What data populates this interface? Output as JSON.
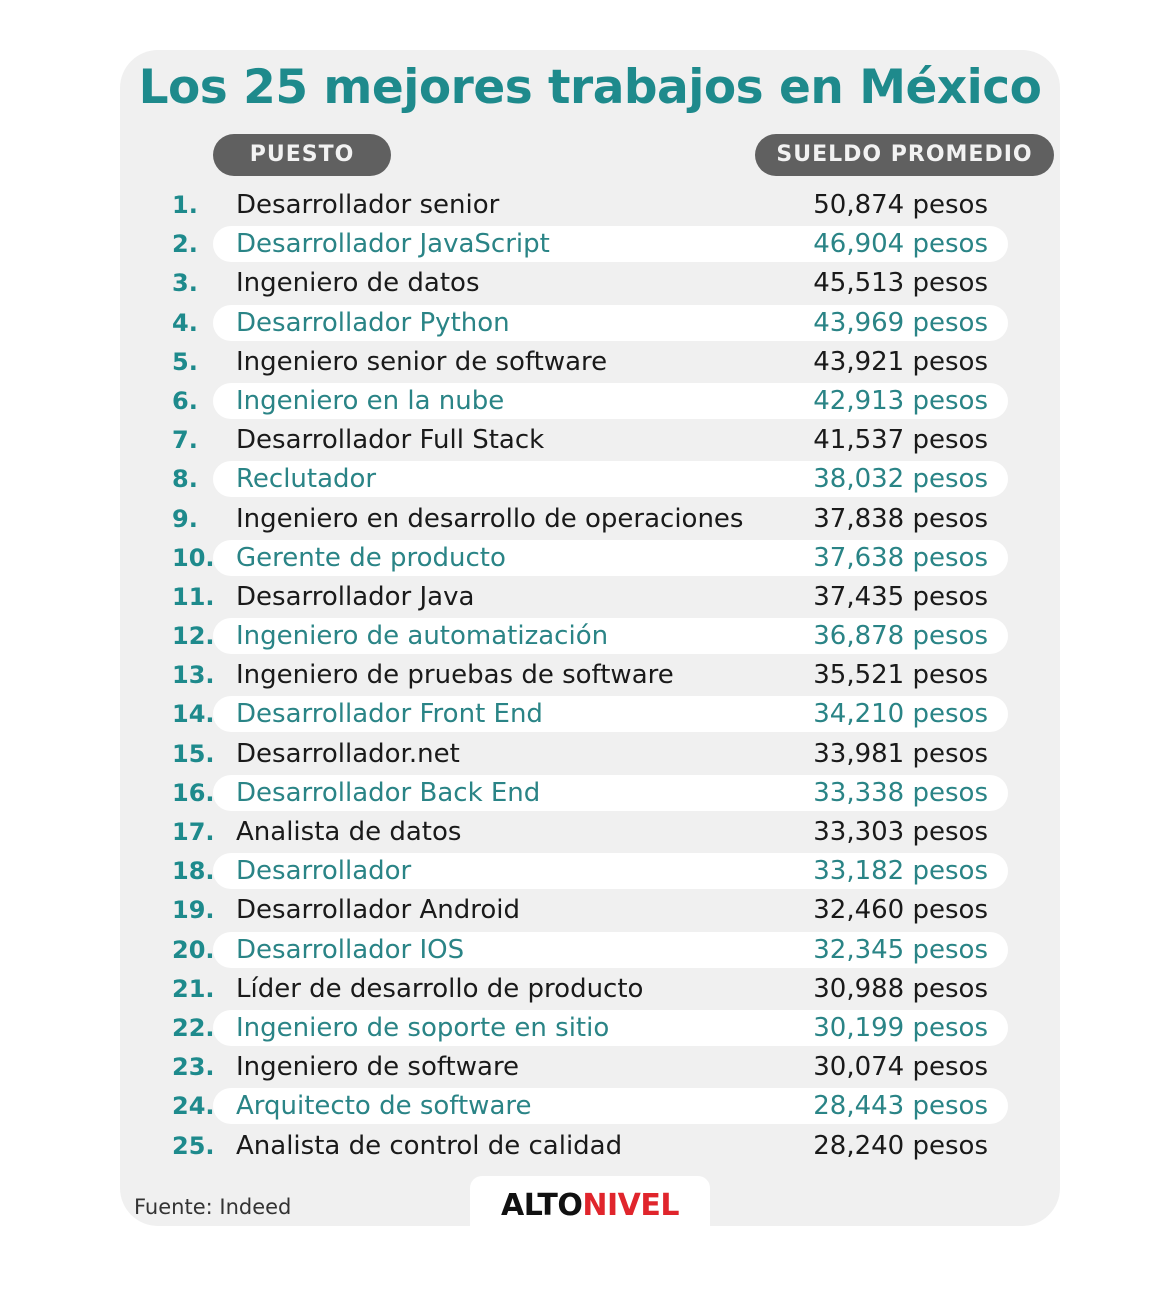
{
  "title": "Los 25 mejores trabajos en México",
  "headers": {
    "puesto": "PUESTO",
    "sueldo": "SUELDO PROMEDIO"
  },
  "rows": [
    {
      "rank": "1.",
      "job": "Desarrollador senior",
      "salary": "50,874 pesos"
    },
    {
      "rank": "2.",
      "job": "Desarrollador JavaScript",
      "salary": "46,904 pesos"
    },
    {
      "rank": "3.",
      "job": "Ingeniero de datos",
      "salary": "45,513 pesos"
    },
    {
      "rank": "4.",
      "job": "Desarrollador Python",
      "salary": "43,969 pesos"
    },
    {
      "rank": "5.",
      "job": "Ingeniero senior de software",
      "salary": "43,921 pesos"
    },
    {
      "rank": "6.",
      "job": "Ingeniero en la nube",
      "salary": "42,913 pesos"
    },
    {
      "rank": "7.",
      "job": "Desarrollador Full Stack",
      "salary": "41,537 pesos"
    },
    {
      "rank": "8.",
      "job": "Reclutador",
      "salary": "38,032 pesos"
    },
    {
      "rank": "9.",
      "job": "Ingeniero en desarrollo de operaciones",
      "salary": "37,838 pesos"
    },
    {
      "rank": "10.",
      "job": "Gerente de producto",
      "salary": "37,638 pesos"
    },
    {
      "rank": "11.",
      "job": "Desarrollador Java",
      "salary": "37,435 pesos"
    },
    {
      "rank": "12.",
      "job": "Ingeniero de automatización",
      "salary": "36,878 pesos"
    },
    {
      "rank": "13.",
      "job": "Ingeniero de pruebas de software",
      "salary": "35,521 pesos"
    },
    {
      "rank": "14.",
      "job": "Desarrollador Front End",
      "salary": "34,210 pesos"
    },
    {
      "rank": "15.",
      "job": "Desarrollador.net",
      "salary": "33,981 pesos"
    },
    {
      "rank": "16.",
      "job": "Desarrollador Back End",
      "salary": "33,338 pesos"
    },
    {
      "rank": "17.",
      "job": "Analista de datos",
      "salary": "33,303 pesos"
    },
    {
      "rank": "18.",
      "job": "Desarrollador",
      "salary": "33,182 pesos"
    },
    {
      "rank": "19.",
      "job": "Desarrollador Android",
      "salary": "32,460 pesos"
    },
    {
      "rank": "20.",
      "job": "Desarrollador IOS",
      "salary": "32,345 pesos"
    },
    {
      "rank": "21.",
      "job": "Líder de desarrollo de producto",
      "salary": "30,988 pesos"
    },
    {
      "rank": "22.",
      "job": "Ingeniero de soporte en sitio",
      "salary": "30,199 pesos"
    },
    {
      "rank": "23.",
      "job": "Ingeniero de software",
      "salary": "30,074 pesos"
    },
    {
      "rank": "24.",
      "job": "Arquitecto de software",
      "salary": "28,443 pesos"
    },
    {
      "rank": "25.",
      "job": "Analista de control de calidad",
      "salary": "28,240 pesos"
    }
  ],
  "source": "Fuente: Indeed",
  "logo": {
    "part1": "ALTO",
    "part2": "NIVEL"
  },
  "colors": {
    "teal": "#1e8a8c",
    "pill": "#606060",
    "card": "#f0f0f0",
    "logo_red": "#e0252c"
  }
}
